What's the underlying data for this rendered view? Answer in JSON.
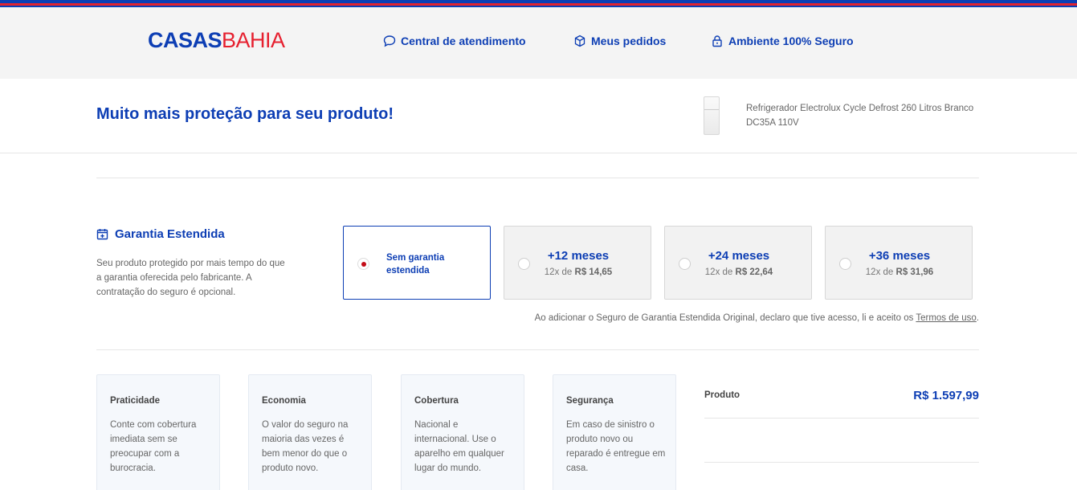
{
  "header": {
    "logo_casas": "CASAS",
    "logo_bahia": "BAHIA",
    "links": [
      {
        "label": "Central de atendimento",
        "icon": "chat-bubble-icon"
      },
      {
        "label": "Meus pedidos",
        "icon": "package-box-icon"
      },
      {
        "label": "Ambiente 100% Seguro",
        "icon": "padlock-icon"
      }
    ]
  },
  "subheader": {
    "title": "Muito mais proteção para seu produto!",
    "product_name": "Refrigerador Electrolux Cycle Defrost 260 Litros Branco DC35A 110V",
    "product_image_icon": "refrigerator-icon"
  },
  "warranty": {
    "title": "Garantia Estendida",
    "icon": "calendar-plus-icon",
    "description": "Seu produto protegido por mais tempo do que a garantia oferecida pelo fabricante. A contratação do seguro é opcional.",
    "options": [
      {
        "label": "Sem garantia estendida",
        "selected": true
      },
      {
        "months": "+12 meses",
        "installment_prefix": "12x de",
        "installment_value": "R$ 14,65",
        "selected": false
      },
      {
        "months": "+24 meses",
        "installment_prefix": "12x de",
        "installment_value": "R$ 22,64",
        "selected": false
      },
      {
        "months": "+36 meses",
        "installment_prefix": "12x de",
        "installment_value": "R$ 31,96",
        "selected": false
      }
    ],
    "terms_text": "Ao adicionar o Seguro de Garantia Estendida Original, declaro que tive acesso, li e aceito os ",
    "terms_link": "Termos de uso",
    "terms_end": "."
  },
  "benefits": [
    {
      "title": "Praticidade",
      "text": "Conte com cobertura imediata sem se preocupar com a burocracia."
    },
    {
      "title": "Economia",
      "text": "O valor do seguro na maioria das vezes é bem menor do que o produto novo."
    },
    {
      "title": "Cobertura",
      "text": "Nacional e internacional. Use o aparelho em qualquer lugar do mundo."
    },
    {
      "title": "Segurança",
      "text": "Em caso de sinistro o produto novo ou reparado é entregue em casa."
    }
  ],
  "summary": {
    "product_label": "Produto",
    "product_value": "R$ 1.597,99"
  },
  "colors": {
    "brand_blue": "#0d3eb4",
    "brand_red": "#e6202f",
    "selected_dot": "#c40c18"
  }
}
